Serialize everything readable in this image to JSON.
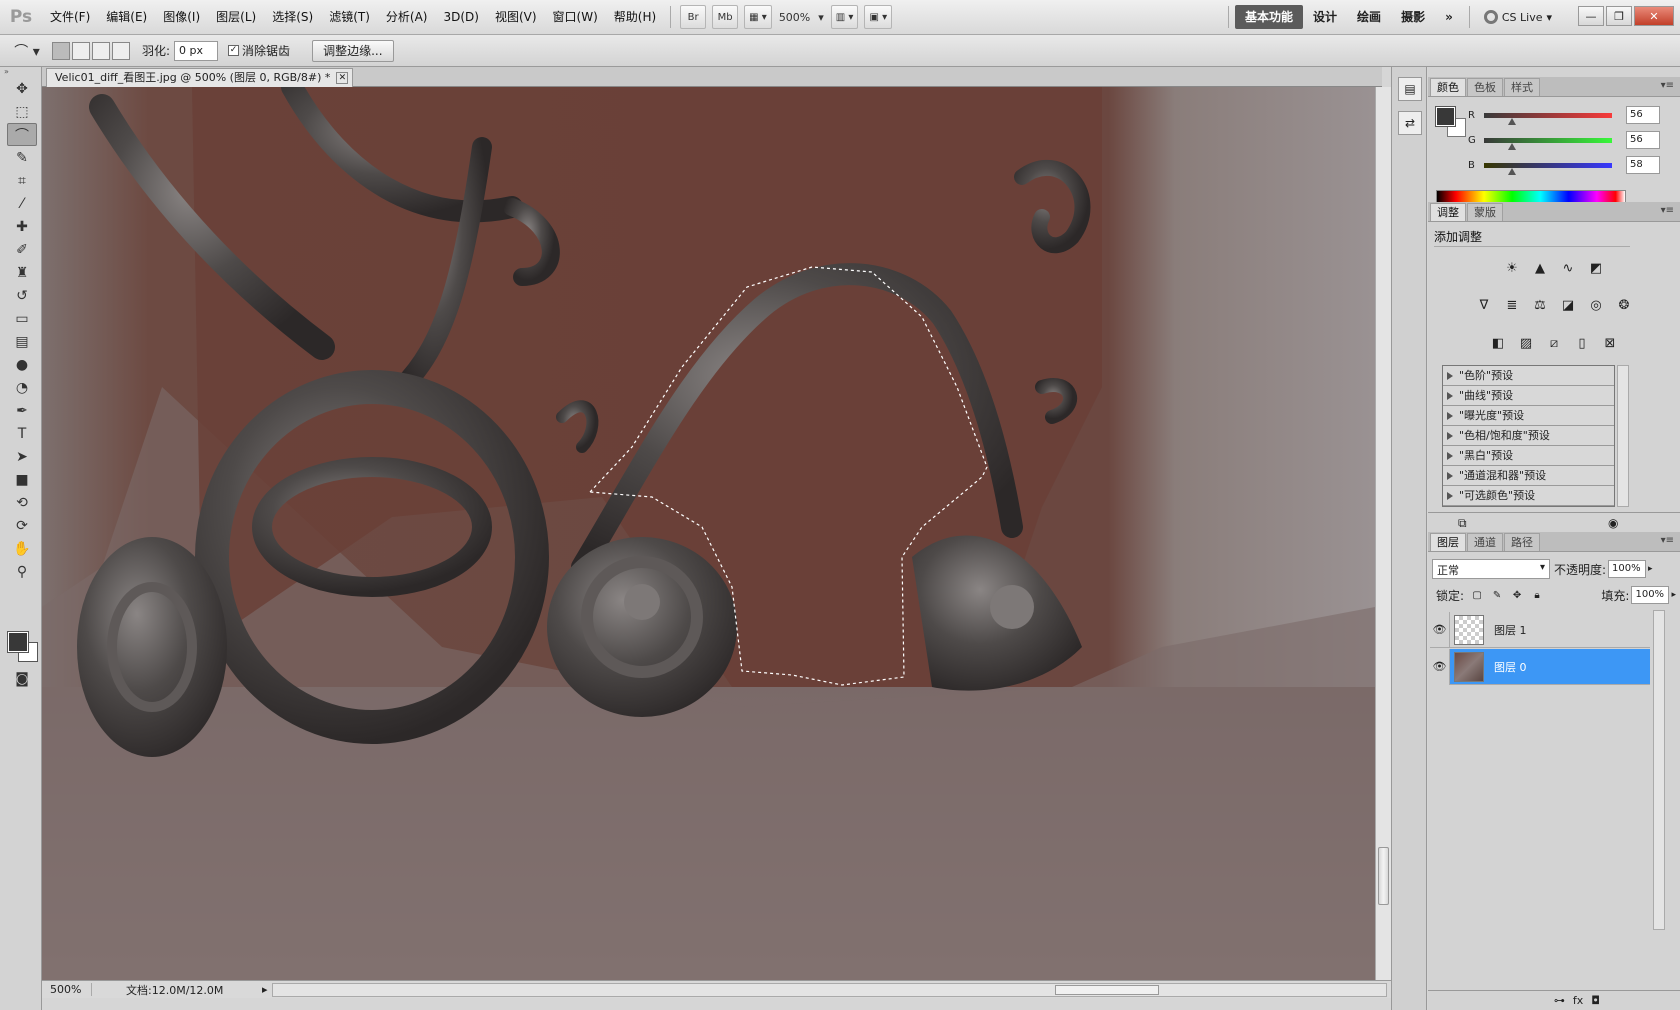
{
  "menubar": {
    "logo": "Ps",
    "items": [
      "文件(F)",
      "编辑(E)",
      "图像(I)",
      "图层(L)",
      "选择(S)",
      "滤镜(T)",
      "分析(A)",
      "3D(D)",
      "视图(V)",
      "窗口(W)",
      "帮助(H)"
    ],
    "br": "Br",
    "mb": "Mb",
    "zoom": "500%",
    "workspaces": [
      "基本功能",
      "设计",
      "绘画",
      "摄影"
    ],
    "more": "»",
    "cslive": "CS Live"
  },
  "options": {
    "feather_label": "羽化:",
    "feather_value": "0 px",
    "antialias_label": "消除锯齿",
    "refine_edge": "调整边缘..."
  },
  "document": {
    "tab_title": "Velic01_diff_看图王.jpg @ 500% (图层 0, RGB/8#) *",
    "status_zoom": "500%",
    "status_info": "文档:12.0M/12.0M"
  },
  "panels": {
    "color_tabs": [
      "颜色",
      "色板",
      "样式"
    ],
    "color": {
      "r_label": "R",
      "r": "56",
      "g_label": "G",
      "g": "56",
      "b_label": "B",
      "b": "58",
      "fg_hex": "#383838",
      "bg_hex": "#ffffff"
    },
    "adj_tabs": [
      "调整",
      "蒙版"
    ],
    "adj_title": "添加调整",
    "presets": [
      "\"色阶\"预设",
      "\"曲线\"预设",
      "\"曝光度\"预设",
      "\"色相/饱和度\"预设",
      "\"黑白\"预设",
      "\"通道混和器\"预设",
      "\"可选颜色\"预设"
    ],
    "layers_tabs": [
      "图层",
      "通道",
      "路径"
    ],
    "blend_mode": "正常",
    "opacity_label": "不透明度:",
    "opacity": "100%",
    "lock_label": "锁定:",
    "fill_label": "填充:",
    "fill": "100%",
    "layers": [
      {
        "name": "图层 1",
        "selected": false
      },
      {
        "name": "图层 0",
        "selected": true
      }
    ],
    "accent": "#3d97f5"
  }
}
